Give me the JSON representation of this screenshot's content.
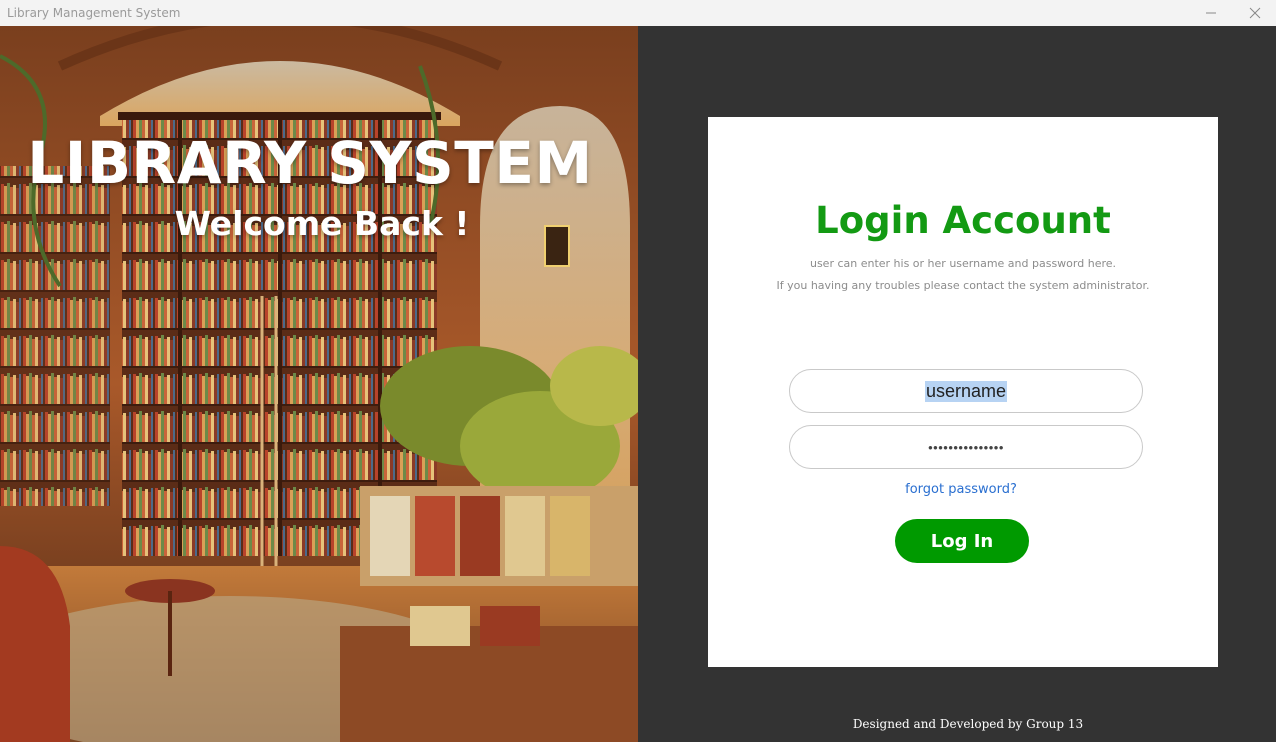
{
  "window": {
    "title": "Library Management System",
    "minimize_icon": "minimize-icon",
    "close_icon": "close-icon"
  },
  "hero": {
    "title": "LIBRARY SYSTEM",
    "subtitle": "Welcome Back !"
  },
  "login": {
    "heading": "Login Account",
    "description_line1": "user can enter his or her username and password here.",
    "description_line2": "If you having any troubles please contact the system administrator.",
    "username_value": "username",
    "password_value": "•••••••••••••••",
    "forgot_label": "forgot password?",
    "login_label": "Log In"
  },
  "footer": {
    "text": "Designed and Developed by Group 13"
  },
  "colors": {
    "accent": "#009a00",
    "heading": "#139a13",
    "background": "#333333",
    "link": "#2a6fd0"
  }
}
